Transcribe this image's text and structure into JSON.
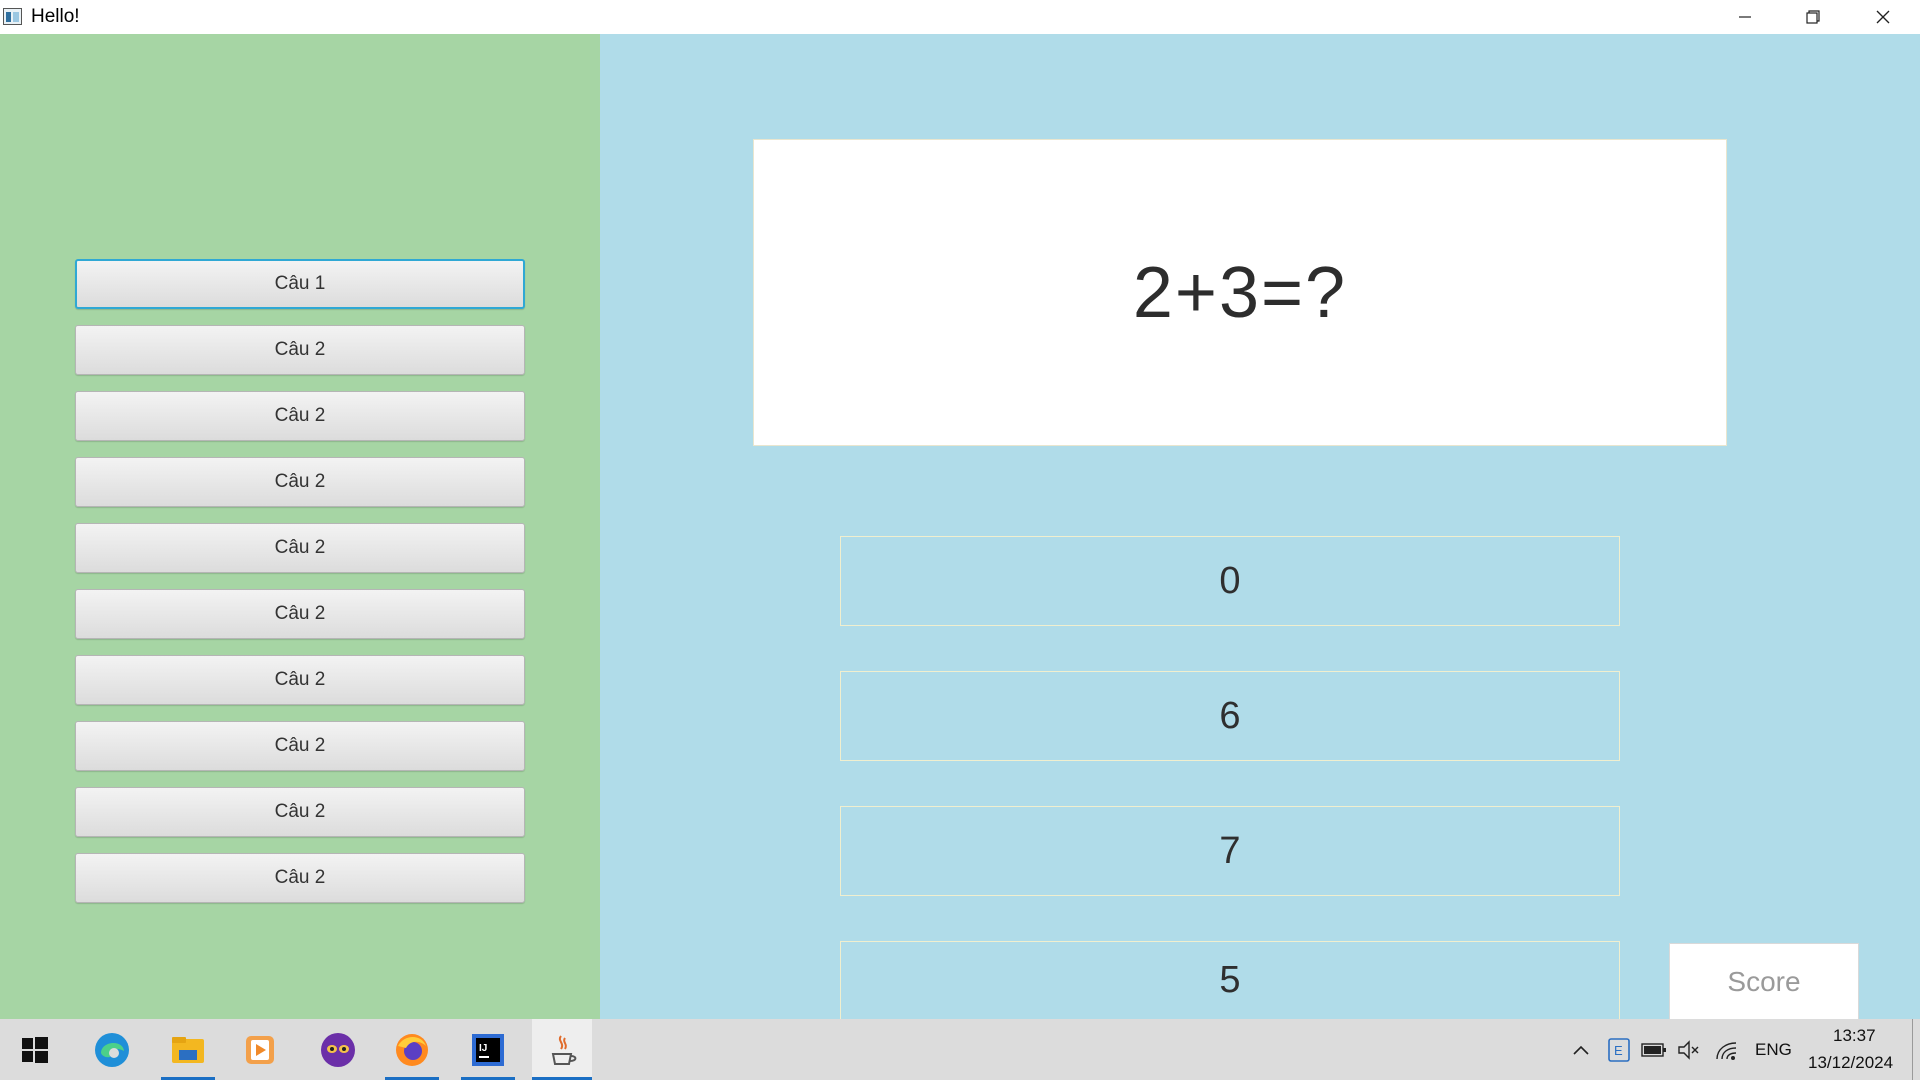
{
  "window": {
    "title": "Hello!"
  },
  "sidebar": {
    "questions": [
      {
        "label": "Câu 1",
        "selected": true
      },
      {
        "label": "Câu 2"
      },
      {
        "label": "Câu 2"
      },
      {
        "label": "Câu 2"
      },
      {
        "label": "Câu 2"
      },
      {
        "label": "Câu 2"
      },
      {
        "label": "Câu 2"
      },
      {
        "label": "Câu 2"
      },
      {
        "label": "Câu 2"
      },
      {
        "label": "Câu 2"
      }
    ]
  },
  "main": {
    "question": "2+3=?",
    "answers": [
      "0",
      "6",
      "7",
      "5"
    ],
    "score_label": "Score"
  },
  "taskbar": {
    "apps": [
      "windows-start-icon",
      "edge-browser-icon",
      "file-explorer-icon",
      "media-player-icon",
      "game-mask-icon",
      "firefox-icon",
      "intellij-icon",
      "java-app-icon"
    ],
    "tray": {
      "language": "ENG",
      "time": "13:37",
      "date": "13/12/2024"
    }
  },
  "colors": {
    "left_panel": "#a6d5a4",
    "right_panel": "#b0dce9",
    "active_outline": "#2fa8d4"
  }
}
